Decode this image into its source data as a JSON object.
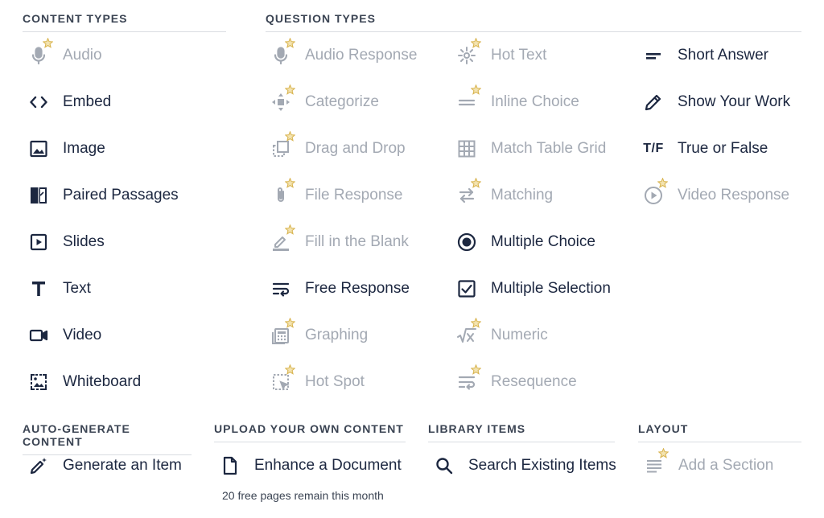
{
  "headers": {
    "content_types": "CONTENT TYPES",
    "question_types": "QUESTION TYPES",
    "auto_generate": "AUTO-GENERATE CONTENT",
    "upload": "UPLOAD YOUR OWN CONTENT",
    "library": "LIBRARY ITEMS",
    "layout": "LAYOUT"
  },
  "content_types": [
    {
      "label": "Audio",
      "icon": "microphone-icon",
      "enabled": false
    },
    {
      "label": "Embed",
      "icon": "code-icon",
      "enabled": true
    },
    {
      "label": "Image",
      "icon": "image-icon",
      "enabled": true
    },
    {
      "label": "Paired Passages",
      "icon": "paired-passages-icon",
      "enabled": true
    },
    {
      "label": "Slides",
      "icon": "slides-icon",
      "enabled": true
    },
    {
      "label": "Text",
      "icon": "text-icon",
      "enabled": true
    },
    {
      "label": "Video",
      "icon": "video-camera-icon",
      "enabled": true
    },
    {
      "label": "Whiteboard",
      "icon": "whiteboard-icon",
      "enabled": true
    }
  ],
  "question_types_col1": [
    {
      "label": "Audio Response",
      "icon": "microphone-icon",
      "enabled": false
    },
    {
      "label": "Categorize",
      "icon": "categorize-icon",
      "enabled": false
    },
    {
      "label": "Drag and Drop",
      "icon": "drag-drop-icon",
      "enabled": false
    },
    {
      "label": "File Response",
      "icon": "paperclip-icon",
      "enabled": false
    },
    {
      "label": "Fill in the Blank",
      "icon": "fill-blank-icon",
      "enabled": false
    },
    {
      "label": "Free Response",
      "icon": "text-wrap-icon",
      "enabled": true
    },
    {
      "label": "Graphing",
      "icon": "calculator-icon",
      "enabled": false
    },
    {
      "label": "Hot Spot",
      "icon": "hot-spot-icon",
      "enabled": false
    }
  ],
  "question_types_col2": [
    {
      "label": "Hot Text",
      "icon": "hot-text-icon",
      "enabled": false
    },
    {
      "label": "Inline Choice",
      "icon": "inline-choice-icon",
      "enabled": false
    },
    {
      "label": "Match Table Grid",
      "icon": "grid-icon",
      "enabled": false
    },
    {
      "label": "Matching",
      "icon": "swap-arrows-icon",
      "enabled": false
    },
    {
      "label": "Multiple Choice",
      "icon": "radio-button-icon",
      "enabled": true
    },
    {
      "label": "Multiple Selection",
      "icon": "checkbox-icon",
      "enabled": true
    },
    {
      "label": "Numeric",
      "icon": "square-root-icon",
      "enabled": false
    },
    {
      "label": "Resequence",
      "icon": "resequence-icon",
      "enabled": false
    }
  ],
  "question_types_col3": [
    {
      "label": "Short Answer",
      "icon": "short-answer-icon",
      "enabled": true
    },
    {
      "label": "Show Your Work",
      "icon": "pencil-icon",
      "enabled": true
    },
    {
      "label": "True or False",
      "icon": "true-false-icon",
      "icon_text": "T/F",
      "enabled": true
    },
    {
      "label": "Video Response",
      "icon": "play-circle-icon",
      "enabled": false
    }
  ],
  "auto_generate": {
    "label": "Generate an Item",
    "icon": "magic-wand-icon"
  },
  "upload": {
    "label": "Enhance a Document",
    "icon": "document-icon",
    "note": "20 free pages remain this month"
  },
  "library": {
    "label": "Search Existing Items",
    "icon": "search-icon"
  },
  "layout": {
    "label": "Add a Section",
    "icon": "section-lines-icon",
    "enabled": false
  },
  "colors": {
    "active": "#1c2740",
    "disabled": "#a3a9b3",
    "star": "#d9b552",
    "header": "#3b4453"
  }
}
